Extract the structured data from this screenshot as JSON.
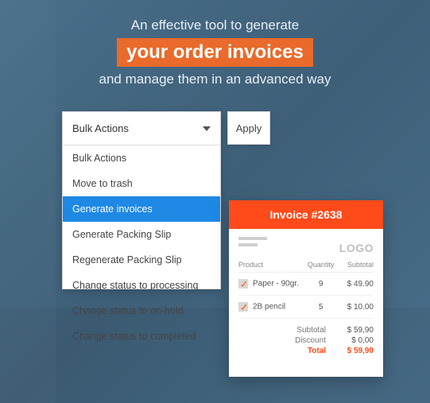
{
  "hero": {
    "line1": "An effective tool to generate",
    "highlight": "your order invoices",
    "line3": "and manage them in an advanced way"
  },
  "bulk": {
    "selected_label": "Bulk Actions",
    "apply_label": "Apply",
    "options": [
      "Bulk Actions",
      "Move to trash",
      "Generate invoices",
      "Generate Packing Slip",
      "Regenerate Packing Slip",
      "Change status to processing",
      "Change status to on-hold",
      "Change status to completed"
    ],
    "selected_index": 2
  },
  "invoice": {
    "title": "Invoice #2638",
    "logo_text": "LOGO",
    "columns": {
      "product": "Product",
      "quantity": "Quantity",
      "subtotal": "Subtotal"
    },
    "items": [
      {
        "name": "Paper - 90gr.",
        "qty": "9",
        "subtotal": "$ 49.90"
      },
      {
        "name": "2B pencil",
        "qty": "5",
        "subtotal": "$ 10.00"
      }
    ],
    "totals": {
      "subtotal_label": "Subtotal",
      "subtotal_value": "$ 59,90",
      "discount_label": "Discount",
      "discount_value": "$ 0,00",
      "total_label": "Total",
      "total_value": "$ 59,90"
    }
  }
}
